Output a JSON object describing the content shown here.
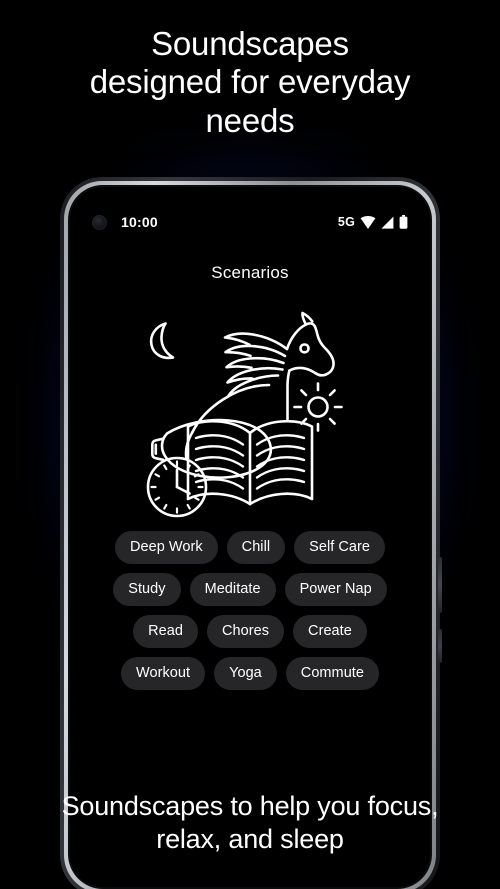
{
  "promo": {
    "headline": "Soundscapes\ndesigned for everyday\nneeds",
    "caption": "Soundscapes to help you focus,\nrelax, and sleep"
  },
  "theme": {
    "background": "#000000",
    "glow_accent": "#1a3fd0",
    "chip_background": "#262628",
    "chip_text": "#ffffff",
    "screen_background": "#000000",
    "art_stroke": "#ffffff",
    "phone_bezel": "#c9ccd1"
  },
  "phone": {
    "status_bar": {
      "camera": "punch-hole-camera",
      "time": "10:00",
      "network": "5G",
      "icons": [
        "wifi-icon",
        "cellular-signal-icon",
        "battery-icon"
      ]
    },
    "screen": {
      "title": "Scenarios",
      "illustration": {
        "name": "scenarios-illustration",
        "elements": [
          "crescent-moon-icon",
          "horse-head-icon",
          "sun-icon",
          "sleep-mask-icon",
          "open-book-icon",
          "analog-clock-icon"
        ]
      },
      "chip_rows": [
        [
          "Deep Work",
          "Chill",
          "Self Care"
        ],
        [
          "Study",
          "Meditate",
          "Power Nap"
        ],
        [
          "Read",
          "Chores",
          "Create"
        ],
        [
          "Workout",
          "Yoga",
          "Commute"
        ]
      ]
    }
  }
}
